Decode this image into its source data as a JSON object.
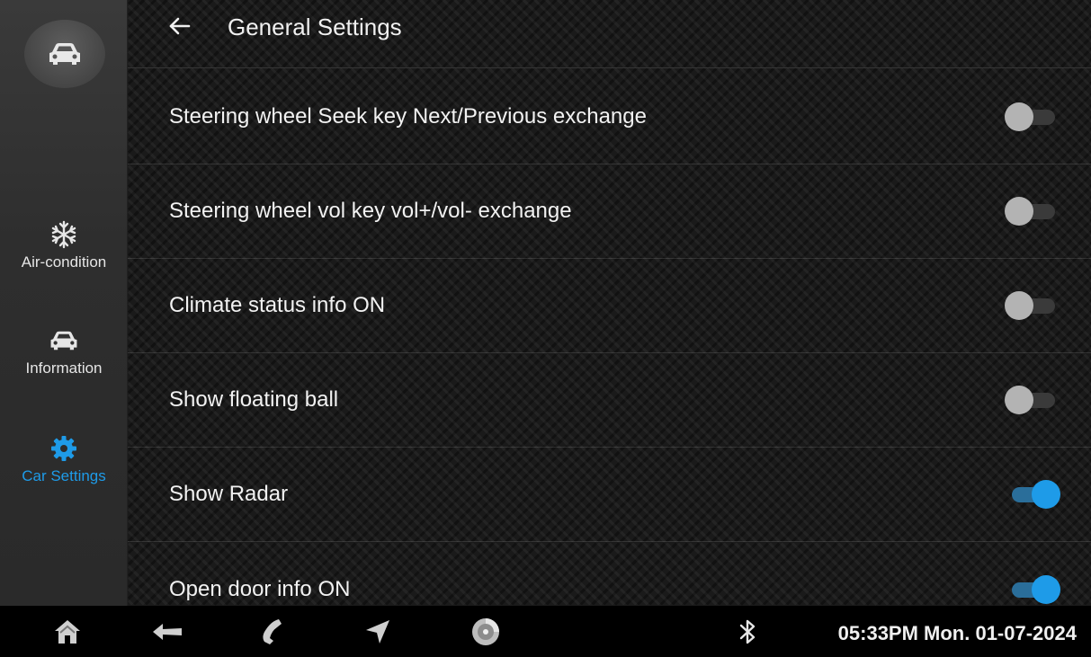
{
  "header": {
    "title": "General Settings"
  },
  "sidebar": {
    "items": [
      {
        "label": "Air-condition",
        "icon": "snowflake-icon",
        "active": false
      },
      {
        "label": "Information",
        "icon": "car-icon",
        "active": false
      },
      {
        "label": "Car Settings",
        "icon": "gear-icon",
        "active": true
      }
    ]
  },
  "settings": [
    {
      "label": "Steering wheel Seek key Next/Previous exchange",
      "enabled": false
    },
    {
      "label": "Steering wheel vol key vol+/vol- exchange",
      "enabled": false
    },
    {
      "label": "Climate status info ON",
      "enabled": false
    },
    {
      "label": "Show floating ball",
      "enabled": false
    },
    {
      "label": "Show Radar",
      "enabled": true
    },
    {
      "label": "Open door info ON",
      "enabled": true
    }
  ],
  "bottombar": {
    "icons": [
      "home-icon",
      "back-icon",
      "phone-icon",
      "navigation-icon",
      "media-icon",
      "bluetooth-icon"
    ],
    "clock": "05:33PM Mon. 01-07-2024"
  },
  "colors": {
    "accent": "#1e9be8",
    "toggle_off": "#b3b3b3",
    "background": "#1a1a1a"
  }
}
